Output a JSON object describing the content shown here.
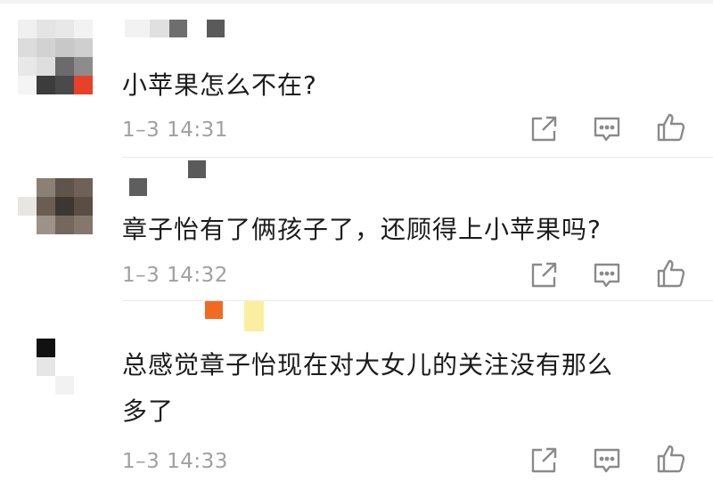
{
  "comments": [
    {
      "text": "小苹果怎么不在?",
      "time": "1–3 14:31"
    },
    {
      "text": "章子怡有了俩孩子了，还顾得上小苹果吗?",
      "time": "1–3 14:32"
    },
    {
      "text": "总感觉章子怡现在对大女儿的关注没有那么\n多了",
      "time": "1–3 14:33"
    }
  ],
  "icons": {
    "share": "share-icon",
    "reply": "comment-icon",
    "like": "thumbs-up-icon"
  },
  "colors": {
    "text": "#1c1c1c",
    "meta": "#a0a0a0",
    "icon": "#8a8a8a"
  }
}
